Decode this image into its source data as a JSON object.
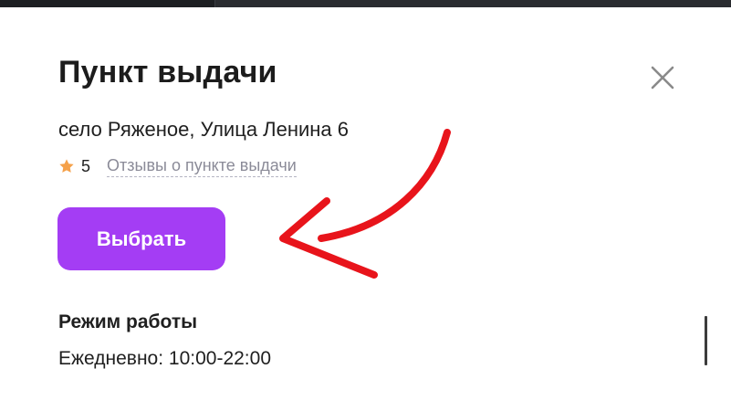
{
  "pickup_point": {
    "title": "Пункт выдачи",
    "address": "село Ряженое, Улица Ленина 6",
    "rating": "5",
    "reviews_link": "Отзывы о пункте выдачи",
    "select_button": "Выбрать",
    "hours_title": "Режим работы",
    "hours_value": "Ежедневно: 10:00-22:00"
  },
  "icons": {
    "close": "close-icon",
    "rating": "star-icon"
  },
  "colors": {
    "accent": "#a43df4",
    "star": "#f5a14a",
    "link": "#8b8b98",
    "annotation": "#e8141b"
  }
}
